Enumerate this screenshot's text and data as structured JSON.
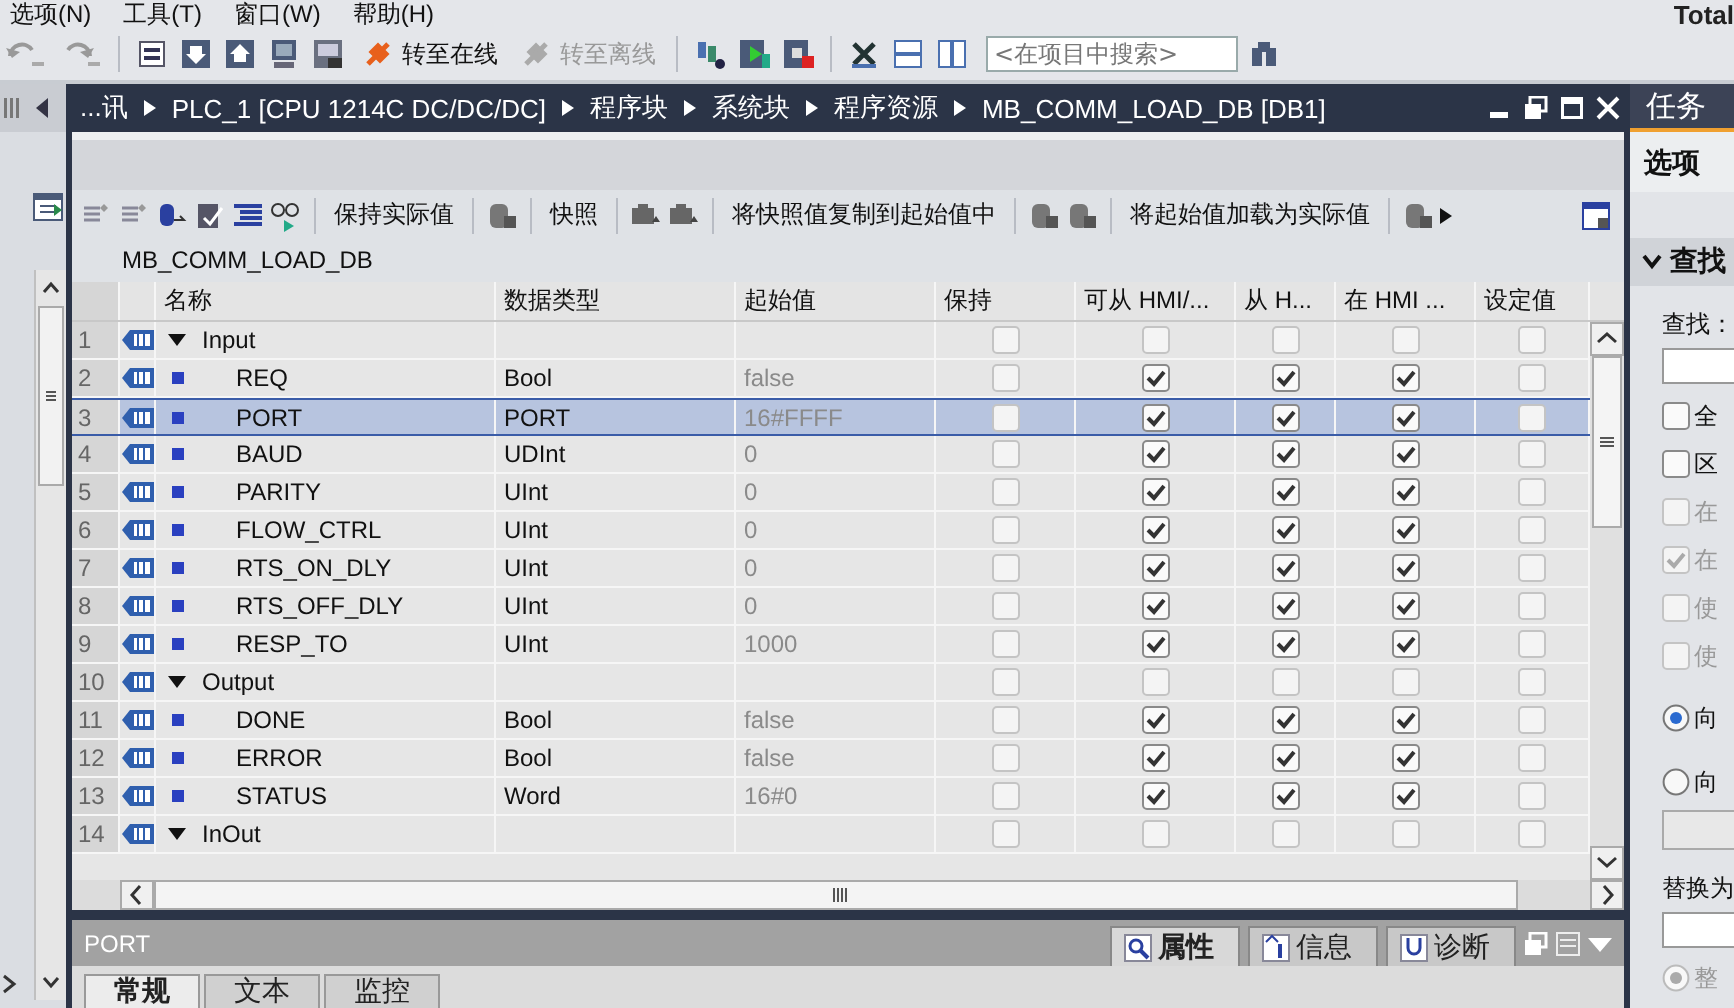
{
  "menu_bar": {
    "items": [
      "选项(N)",
      "工具(T)",
      "窗口(W)",
      "帮助(H)"
    ],
    "brand": "Total"
  },
  "toolbar": {
    "actions": [
      {
        "label": "转至在线",
        "disabled": false
      },
      {
        "label": "转至离线",
        "disabled": true
      }
    ],
    "search_placeholder": "<在项目中搜索>"
  },
  "editor": {
    "breadcrumb": [
      "...讯",
      "PLC_1 [CPU 1214C DC/DC/DC]",
      "程序块",
      "系统块",
      "程序资源",
      "MB_COMM_LOAD_DB [DB1]"
    ],
    "toolbar": [
      "保持实际值",
      "快照",
      "将快照值复制到起始值中",
      "将起始值加载为实际值"
    ],
    "block_name": "MB_COMM_LOAD_DB",
    "table": {
      "columns": [
        "名称",
        "数据类型",
        "起始值",
        "保持",
        "可从 HMI/...",
        "从 H...",
        "在 HMI ...",
        "设定值"
      ],
      "rows": [
        {
          "number": "1",
          "kind": "group",
          "name": "Input",
          "expanded": true,
          "selected": false,
          "checks": [
            false,
            false,
            false,
            false,
            false
          ]
        },
        {
          "number": "2",
          "kind": "member",
          "name": "REQ",
          "type": "Bool",
          "start": "false",
          "selected": false,
          "checks": [
            false,
            true,
            true,
            true,
            false
          ]
        },
        {
          "number": "3",
          "kind": "member",
          "name": "PORT",
          "type": "PORT",
          "start": "16#FFFF",
          "selected": true,
          "checks": [
            false,
            true,
            true,
            true,
            false
          ]
        },
        {
          "number": "4",
          "kind": "member",
          "name": "BAUD",
          "type": "UDInt",
          "start": "0",
          "selected": false,
          "checks": [
            false,
            true,
            true,
            true,
            false
          ]
        },
        {
          "number": "5",
          "kind": "member",
          "name": "PARITY",
          "type": "UInt",
          "start": "0",
          "selected": false,
          "checks": [
            false,
            true,
            true,
            true,
            false
          ]
        },
        {
          "number": "6",
          "kind": "member",
          "name": "FLOW_CTRL",
          "type": "UInt",
          "start": "0",
          "selected": false,
          "checks": [
            false,
            true,
            true,
            true,
            false
          ]
        },
        {
          "number": "7",
          "kind": "member",
          "name": "RTS_ON_DLY",
          "type": "UInt",
          "start": "0",
          "selected": false,
          "checks": [
            false,
            true,
            true,
            true,
            false
          ]
        },
        {
          "number": "8",
          "kind": "member",
          "name": "RTS_OFF_DLY",
          "type": "UInt",
          "start": "0",
          "selected": false,
          "checks": [
            false,
            true,
            true,
            true,
            false
          ]
        },
        {
          "number": "9",
          "kind": "member",
          "name": "RESP_TO",
          "type": "UInt",
          "start": "1000",
          "selected": false,
          "checks": [
            false,
            true,
            true,
            true,
            false
          ]
        },
        {
          "number": "10",
          "kind": "group",
          "name": "Output",
          "expanded": true,
          "selected": false,
          "checks": [
            false,
            false,
            false,
            false,
            false
          ]
        },
        {
          "number": "11",
          "kind": "member",
          "name": "DONE",
          "type": "Bool",
          "start": "false",
          "selected": false,
          "checks": [
            false,
            true,
            true,
            true,
            false
          ]
        },
        {
          "number": "12",
          "kind": "member",
          "name": "ERROR",
          "type": "Bool",
          "start": "false",
          "selected": false,
          "checks": [
            false,
            true,
            true,
            true,
            false
          ]
        },
        {
          "number": "13",
          "kind": "member",
          "name": "STATUS",
          "type": "Word",
          "start": "16#0",
          "selected": false,
          "checks": [
            false,
            true,
            true,
            true,
            false
          ]
        },
        {
          "number": "14",
          "kind": "group",
          "name": "InOut",
          "expanded": true,
          "selected": false,
          "checks": [
            false,
            false,
            false,
            false,
            false
          ]
        }
      ]
    }
  },
  "properties": {
    "object": "PORT",
    "tabs": [
      {
        "label": "属性",
        "selected": true
      },
      {
        "label": "信息",
        "selected": false
      },
      {
        "label": "诊断",
        "selected": false
      }
    ],
    "subtabs": [
      {
        "label": "常规",
        "selected": true
      },
      {
        "label": "文本",
        "selected": false
      },
      {
        "label": "监控",
        "selected": false
      }
    ]
  },
  "task_panel": {
    "title": "任务",
    "pane": "选项",
    "section": {
      "title": "查找",
      "expanded": true
    },
    "find_label": "查找：",
    "options": [
      {
        "label": "全",
        "checked": false,
        "disabled": false
      },
      {
        "label": "区",
        "checked": false,
        "disabled": false
      },
      {
        "label": "在",
        "checked": false,
        "disabled": true
      },
      {
        "label": "在",
        "checked": true,
        "disabled": true
      },
      {
        "label": "使",
        "checked": false,
        "disabled": true
      },
      {
        "label": "使",
        "checked": false,
        "disabled": true
      }
    ],
    "directions": [
      {
        "label": "向",
        "selected": true,
        "disabled": false
      },
      {
        "label": "向",
        "selected": false,
        "disabled": false
      }
    ],
    "replace_label": "替换为",
    "scope": [
      {
        "label": "整",
        "selected": true,
        "disabled": true
      }
    ]
  }
}
